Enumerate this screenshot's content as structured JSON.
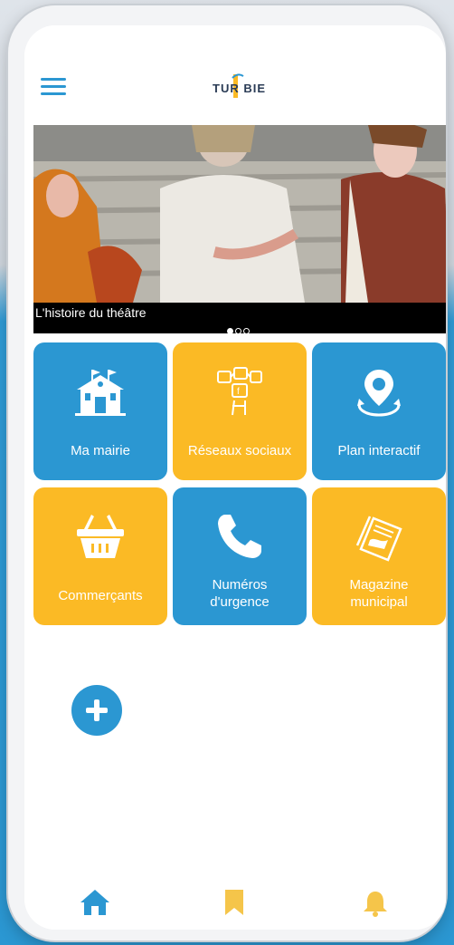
{
  "header": {
    "logo_text": "TUR BIE"
  },
  "banner": {
    "caption": "L'histoire du théâtre",
    "slides": 3,
    "active_slide": 1
  },
  "tiles": [
    {
      "label": "Ma mairie",
      "icon": "town-hall-icon",
      "color": "blue"
    },
    {
      "label": "Réseaux sociaux",
      "icon": "social-network-icon",
      "color": "yellow"
    },
    {
      "label": "Plan interactif",
      "icon": "map-pin-icon",
      "color": "blue"
    },
    {
      "label": "Commerçants",
      "icon": "shopping-basket-icon",
      "color": "yellow"
    },
    {
      "label": "Numéros\nd'urgence",
      "icon": "phone-icon",
      "color": "blue"
    },
    {
      "label": "Magazine\nmunicipal",
      "icon": "newspaper-icon",
      "color": "yellow"
    }
  ],
  "bottom_nav": [
    {
      "icon": "home-icon",
      "active": true
    },
    {
      "icon": "bookmark-icon",
      "active": false
    },
    {
      "icon": "bell-icon",
      "active": false
    }
  ],
  "colors": {
    "blue": "#2b97d2",
    "yellow": "#fbba25",
    "nav_inactive": "#f5c54a"
  }
}
